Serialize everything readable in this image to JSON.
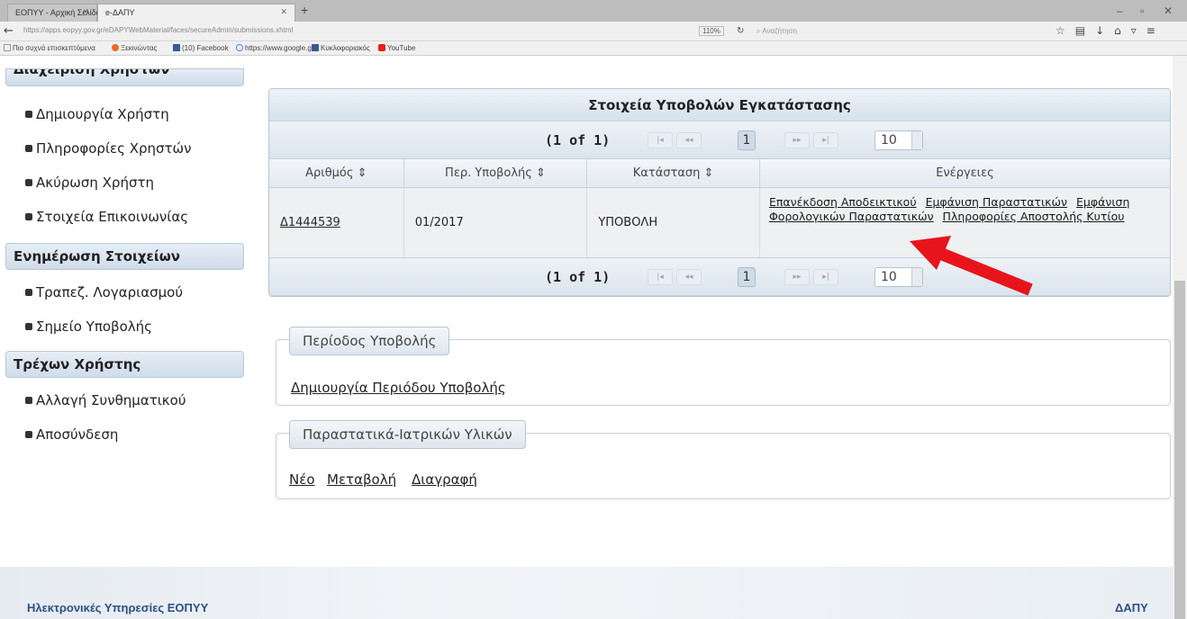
{
  "browser": {
    "tabs": [
      {
        "label": "ΕΟΠΥΥ - Αρχική Σελίδα"
      },
      {
        "label": "e-ΔΑΠΥ"
      }
    ],
    "url": "https://apps.eopyy.gov.gr/eDAPYWebMaterial/faces/secureAdmin/submissions.xhtml",
    "zoom": "110%",
    "search_placeholder": "Αναζήτηση",
    "bookmarks": [
      {
        "label": "Πιο συχνά επισκεπτόμενα",
        "color": "#ffffff"
      },
      {
        "label": "Ξεκινώντας",
        "color": "#e76c25"
      },
      {
        "label": "(10) Facebook",
        "color": "#3b5998"
      },
      {
        "label": "https://www.google.gr/",
        "color": "#4285f4"
      },
      {
        "label": "Κυκλοφοριακός",
        "color": "#3b5998"
      },
      {
        "label": "YouTube",
        "color": "#e62117"
      }
    ]
  },
  "sidebar": {
    "section_users": "Διαχείριση Χρηστών",
    "users_items": [
      {
        "label": "Δημιουργία Χρήστη"
      },
      {
        "label": "Πληροφορίες Χρηστών"
      },
      {
        "label": "Ακύρωση Χρήστη"
      },
      {
        "label": "Στοιχεία Επικοινωνίας"
      }
    ],
    "section_update": "Ενημέρωση Στοιχείων",
    "update_items": [
      {
        "label": "Τραπεζ. Λογαριασμού"
      },
      {
        "label": "Σημείο Υποβολής"
      }
    ],
    "section_current": "Τρέχων Χρήστης",
    "current_items": [
      {
        "label": "Αλλαγή Συνθηματικού"
      },
      {
        "label": "Αποσύνδεση"
      }
    ]
  },
  "submissions": {
    "title": "Στοιχεία Υποβολών Εγκατάστασης",
    "paginator": {
      "count": "(1 of 1)",
      "first": "|◂",
      "prev": "◂◂",
      "page": "1",
      "next": "▸▸",
      "last": "▸|",
      "rows": "10"
    },
    "columns": [
      {
        "label": "Αριθμός ⇕"
      },
      {
        "label": "Περ. Υποβολής ⇕"
      },
      {
        "label": "Κατάσταση ⇕"
      },
      {
        "label": "Ενέργειες"
      }
    ],
    "row": {
      "id": "Δ1444539",
      "period": "01/2017",
      "status": "ΥΠΟΒΟΛΗ",
      "actions": [
        {
          "label": "Επανέκδοση Αποδεικτικού"
        },
        {
          "label": "Εμφάνιση Παραστατικών"
        },
        {
          "label": "Εμφάνιση Φορολογικών Παραστατικών"
        },
        {
          "label": "Πληροφορίες Αποστολής Κυτίου"
        }
      ]
    }
  },
  "period_section": {
    "legend": "Περίοδος Υποβολής",
    "create_link": "Δημιουργία Περιόδου Υποβολής"
  },
  "materials_section": {
    "legend": "Παραστατικά-Ιατρικών Υλικών",
    "new_link": "Νέο",
    "edit_link": "Μεταβολή",
    "delete_link": "Διαγραφή"
  },
  "annotation": {
    "arrow_color": "#e8141c"
  },
  "footer": {
    "left_text": "Ηλεκτρονικές Υπηρεσίες ΕΟΠΥΥ",
    "right_text": "ΔΑΠΥ"
  }
}
